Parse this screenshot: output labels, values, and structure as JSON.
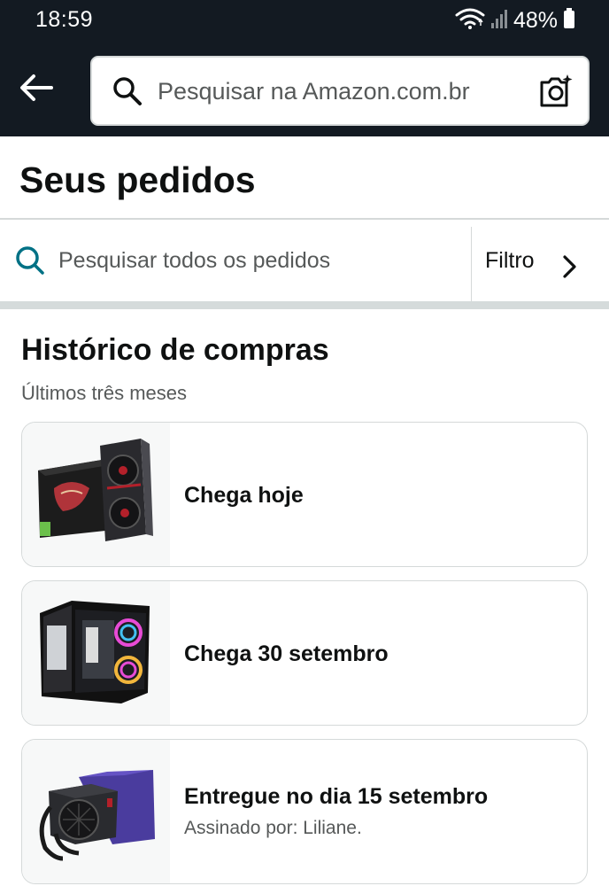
{
  "status_bar": {
    "time": "18:59",
    "battery": "48%",
    "icons": [
      "wifi-icon",
      "signal-icon",
      "battery-icon"
    ]
  },
  "header": {
    "search_placeholder": "Pesquisar na Amazon.com.br",
    "icons": [
      "back-arrow-icon",
      "search-icon",
      "camera-search-icon"
    ]
  },
  "page": {
    "title": "Seus pedidos"
  },
  "order_search": {
    "placeholder": "Pesquisar todos os pedidos",
    "filter_label": "Filtro"
  },
  "history": {
    "title": "Histórico de compras",
    "subtitle": "Últimos três meses",
    "orders": [
      {
        "status": "Chega hoje",
        "note": "",
        "product_icon": "graphics-card-image"
      },
      {
        "status": "Chega 30 setembro",
        "note": "",
        "product_icon": "pc-case-image"
      },
      {
        "status": "Entregue no dia 15 setembro",
        "note": "Assinado por: Liliane.",
        "product_icon": "power-supply-image"
      }
    ]
  },
  "colors": {
    "header_bg": "#131a22",
    "search_accent": "#007185",
    "divider": "#d5dbdb"
  }
}
